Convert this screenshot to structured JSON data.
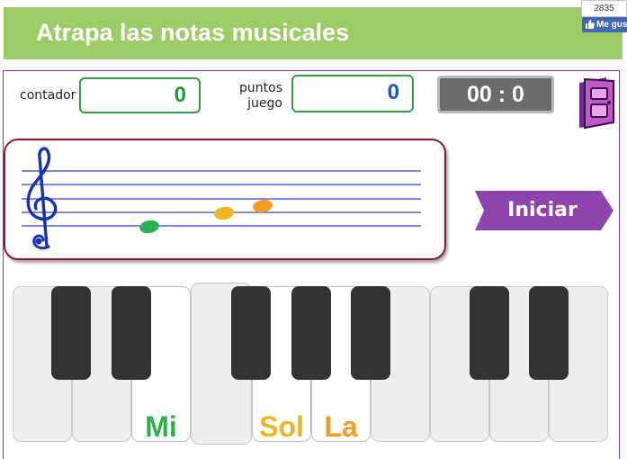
{
  "header": {
    "title": "Atrapa las notas musicales"
  },
  "facebook": {
    "count": "2835",
    "like_label": "Me gusta",
    "brand_color": "#4267b2"
  },
  "stats": {
    "counter_label": "contador",
    "counter_value": "0",
    "points_label_line1": "puntos",
    "points_label_line2": "juego",
    "points_value": "0",
    "timer": "00 : 0"
  },
  "staff": {
    "clef_icon": "treble-clef-icon",
    "notes": [
      {
        "name": "Mi",
        "color": "#2bb24c"
      },
      {
        "name": "Sol",
        "color": "#f0b41c"
      },
      {
        "name": "La",
        "color": "#f39c1f"
      }
    ]
  },
  "controls": {
    "start_label": "Iniciar",
    "start_color": "#8e44ad",
    "exit_icon": "exit-door-icon"
  },
  "keyboard": {
    "labels": {
      "mi": "Mi",
      "sol": "Sol",
      "la": "La"
    },
    "label_colors": {
      "mi": "#2bb24c",
      "sol": "#f0b41c",
      "la": "#f39c1f"
    }
  }
}
